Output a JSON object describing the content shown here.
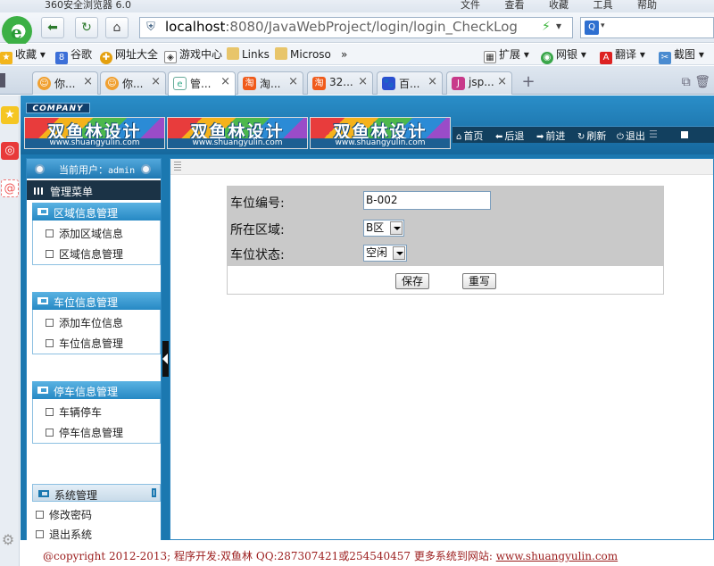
{
  "browser": {
    "app_title": "360安全浏览器 6.0",
    "menu": [
      "文件",
      "查看",
      "收藏",
      "工具",
      "帮助"
    ],
    "url_host": "localhost",
    "url_rest": ":8080/JavaWebProject/login/login_CheckLog",
    "favorites": [
      "收藏",
      "谷歌",
      "网址大全",
      "游戏中心",
      "Links",
      "Microso",
      "»",
      "扩展",
      "网银",
      "翻译",
      "截图"
    ],
    "tabs": [
      {
        "label": "你...",
        "icon": "smiley-icon"
      },
      {
        "label": "你...",
        "icon": "smiley-icon"
      },
      {
        "label": "管...",
        "icon": "page-icon",
        "active": true
      },
      {
        "label": "淘...",
        "icon": "taobao-icon"
      },
      {
        "label": "32...",
        "icon": "taobao-icon"
      },
      {
        "label": "百...",
        "icon": "baidu-icon"
      },
      {
        "label": "jsp...",
        "icon": "jsp-icon"
      }
    ]
  },
  "app": {
    "company": "COMPANY",
    "brand": "双鱼林设计",
    "brand_site": "www.shuangyulin.com",
    "topnav": [
      "首页",
      "后退",
      "前进",
      "刷新",
      "退出"
    ],
    "user_label": "当前用户：",
    "user_name": "admin",
    "menu_title": "管理菜单",
    "groups": [
      {
        "title": "区域信息管理",
        "items": [
          "添加区域信息",
          "区域信息管理"
        ]
      },
      {
        "title": "车位信息管理",
        "items": [
          "添加车位信息",
          "车位信息管理"
        ]
      },
      {
        "title": "停车信息管理",
        "items": [
          "车辆停车",
          "停车信息管理"
        ]
      }
    ],
    "system": {
      "title": "系统管理",
      "items": [
        "修改密码",
        "退出系统"
      ]
    },
    "form": {
      "code_label": "车位编号:",
      "code_value": "B-002",
      "area_label": "所在区域:",
      "area_value": "B区",
      "status_label": "车位状态:",
      "status_value": "空闲",
      "save": "保存",
      "reset": "重写"
    },
    "footer": {
      "text": "@copyright 2012-2013; 程序开发:双鱼林  QQ:287307421或254540457  更多系统到网站: ",
      "link": "www.shuangyulin.com"
    }
  },
  "colors": {
    "chrome_bg": "#e3eaf2",
    "app_blue": "#1b78b0",
    "menu_head_dark": "#1b3346",
    "form_grey": "#c9c9c9",
    "footer_red": "#9b1c1c"
  }
}
